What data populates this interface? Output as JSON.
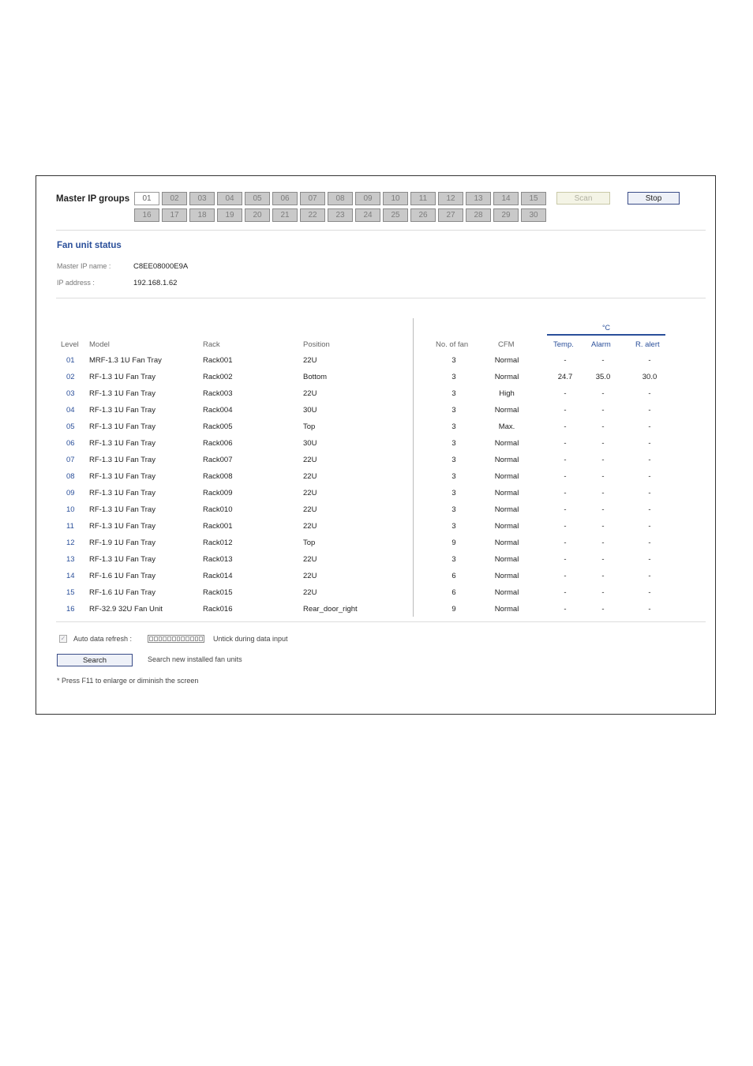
{
  "master_ip_groups": {
    "label": "Master IP groups",
    "row1": [
      "01",
      "02",
      "03",
      "04",
      "05",
      "06",
      "07",
      "08",
      "09",
      "10",
      "11",
      "12",
      "13",
      "14",
      "15"
    ],
    "row2": [
      "16",
      "17",
      "18",
      "19",
      "20",
      "21",
      "22",
      "23",
      "24",
      "25",
      "26",
      "27",
      "28",
      "29",
      "30"
    ],
    "active": "01",
    "scan_label": "Scan",
    "stop_label": "Stop"
  },
  "fan_unit_status": {
    "title": "Fan unit status",
    "master_ip_name_label": "Master IP name :",
    "master_ip_name": "C8EE08000E9A",
    "ip_address_label": "IP address :",
    "ip_address": "192.168.1.62"
  },
  "table": {
    "unit": "°C",
    "headers": {
      "level": "Level",
      "model": "Model",
      "rack": "Rack",
      "position": "Position",
      "no_of_fan": "No. of fan",
      "cfm": "CFM",
      "temp": "Temp.",
      "alarm": "Alarm",
      "r_alert": "R. alert"
    },
    "rows": [
      {
        "level": "01",
        "model": "MRF-1.3 1U Fan Tray",
        "rack": "Rack001",
        "position": "22U",
        "fans": "3",
        "cfm": "Normal",
        "temp": "-",
        "alarm": "-",
        "r_alert": "-"
      },
      {
        "level": "02",
        "model": "RF-1.3 1U Fan Tray",
        "rack": "Rack002",
        "position": "Bottom",
        "fans": "3",
        "cfm": "Normal",
        "temp": "24.7",
        "alarm": "35.0",
        "r_alert": "30.0"
      },
      {
        "level": "03",
        "model": "RF-1.3 1U Fan Tray",
        "rack": "Rack003",
        "position": "22U",
        "fans": "3",
        "cfm": "High",
        "temp": "-",
        "alarm": "-",
        "r_alert": "-"
      },
      {
        "level": "04",
        "model": "RF-1.3 1U Fan Tray",
        "rack": "Rack004",
        "position": "30U",
        "fans": "3",
        "cfm": "Normal",
        "temp": "-",
        "alarm": "-",
        "r_alert": "-"
      },
      {
        "level": "05",
        "model": "RF-1.3 1U Fan Tray",
        "rack": "Rack005",
        "position": "Top",
        "fans": "3",
        "cfm": "Max.",
        "temp": "-",
        "alarm": "-",
        "r_alert": "-"
      },
      {
        "level": "06",
        "model": "RF-1.3 1U Fan Tray",
        "rack": "Rack006",
        "position": "30U",
        "fans": "3",
        "cfm": "Normal",
        "temp": "-",
        "alarm": "-",
        "r_alert": "-"
      },
      {
        "level": "07",
        "model": "RF-1.3 1U Fan Tray",
        "rack": "Rack007",
        "position": "22U",
        "fans": "3",
        "cfm": "Normal",
        "temp": "-",
        "alarm": "-",
        "r_alert": "-"
      },
      {
        "level": "08",
        "model": "RF-1.3 1U Fan Tray",
        "rack": "Rack008",
        "position": "22U",
        "fans": "3",
        "cfm": "Normal",
        "temp": "-",
        "alarm": "-",
        "r_alert": "-"
      },
      {
        "level": "09",
        "model": "RF-1.3 1U Fan Tray",
        "rack": "Rack009",
        "position": "22U",
        "fans": "3",
        "cfm": "Normal",
        "temp": "-",
        "alarm": "-",
        "r_alert": "-"
      },
      {
        "level": "10",
        "model": "RF-1.3 1U Fan Tray",
        "rack": "Rack010",
        "position": "22U",
        "fans": "3",
        "cfm": "Normal",
        "temp": "-",
        "alarm": "-",
        "r_alert": "-"
      },
      {
        "level": "11",
        "model": "RF-1.3 1U Fan Tray",
        "rack": "Rack001",
        "position": "22U",
        "fans": "3",
        "cfm": "Normal",
        "temp": "-",
        "alarm": "-",
        "r_alert": "-"
      },
      {
        "level": "12",
        "model": "RF-1.9 1U Fan Tray",
        "rack": "Rack012",
        "position": "Top",
        "fans": "9",
        "cfm": "Normal",
        "temp": "-",
        "alarm": "-",
        "r_alert": "-"
      },
      {
        "level": "13",
        "model": "RF-1.3 1U Fan Tray",
        "rack": "Rack013",
        "position": "22U",
        "fans": "3",
        "cfm": "Normal",
        "temp": "-",
        "alarm": "-",
        "r_alert": "-"
      },
      {
        "level": "14",
        "model": "RF-1.6 1U Fan Tray",
        "rack": "Rack014",
        "position": "22U",
        "fans": "6",
        "cfm": "Normal",
        "temp": "-",
        "alarm": "-",
        "r_alert": "-"
      },
      {
        "level": "15",
        "model": "RF-1.6 1U Fan Tray",
        "rack": "Rack015",
        "position": "22U",
        "fans": "6",
        "cfm": "Normal",
        "temp": "-",
        "alarm": "-",
        "r_alert": "-"
      },
      {
        "level": "16",
        "model": "RF-32.9 32U Fan Unit",
        "rack": "Rack016",
        "position": "Rear_door_right",
        "fans": "9",
        "cfm": "Normal",
        "temp": "-",
        "alarm": "-",
        "r_alert": "-"
      }
    ]
  },
  "footer": {
    "auto_refresh_label": "Auto data refresh :",
    "auto_refresh_checked": true,
    "refresh_segments": 12,
    "untick_label": "Untick during data input",
    "search_label": "Search",
    "search_desc": "Search new installed fan units",
    "note": "* Press F11 to enlarge or diminish the screen"
  }
}
